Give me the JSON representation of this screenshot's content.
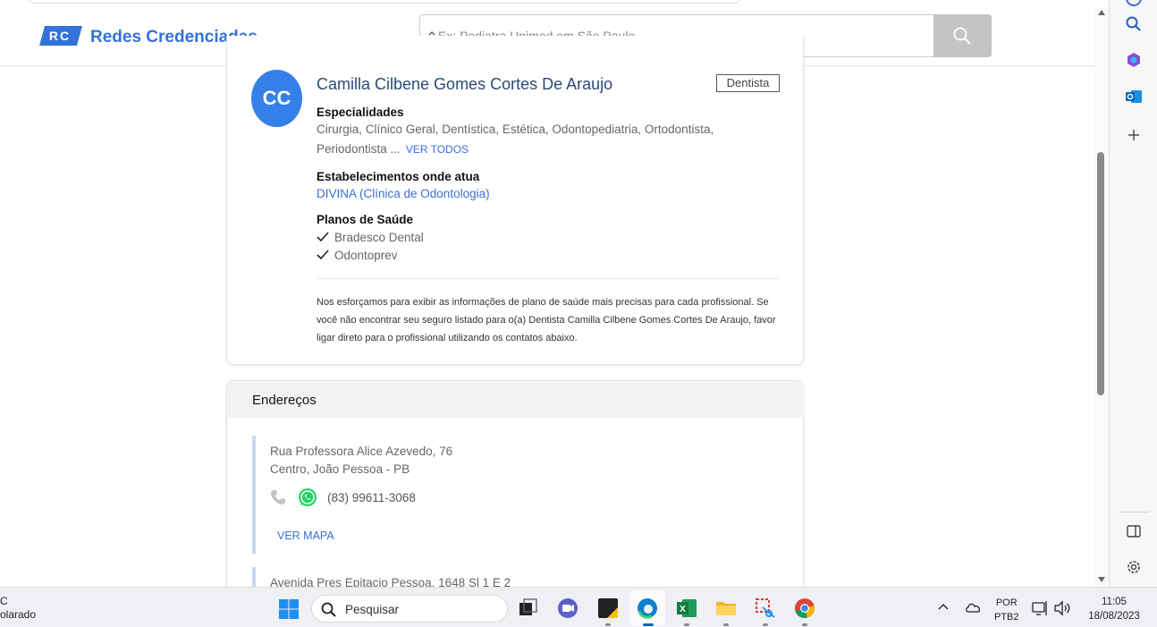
{
  "header": {
    "logo_text": "RC",
    "brand": "Redes Credenciadas",
    "search_placeholder": "Ex: Pediatra Unimed em São Paulo"
  },
  "doctor": {
    "initials": "CC",
    "name": "Camilla Cilbene Gomes Cortes De Araujo",
    "badge": "Dentista",
    "specialties_title": "Especialidades",
    "specialties_line1": "Cirurgia, Clínico Geral, Dentística, Estética, Odontopediatria, Ortodontista,",
    "specialties_line2": "Periodontista ...",
    "see_all": "VER TODOS",
    "establishments_title": "Estabelecimentos onde atua",
    "establishment": "DIVINA (Clínica de Odontologia)",
    "plans_title": "Planos de Saúde",
    "plans": [
      "Bradesco Dental",
      "Odontoprev"
    ],
    "disclaimer": "Nos esforçamos para exibir as informações de plano de saúde mais precisas para cada profissional. Se você não encontrar seu seguro listado para o(a) Dentista Camilla Cilbene Gomes Cortes De Araujo, favor ligar direto para o profissional utilizando os contatos abaixo."
  },
  "addresses": {
    "title": "Endereços",
    "items": [
      {
        "street": "Rua Professora Alice Azevedo, 76",
        "city": "Centro, João Pessoa - PB",
        "phone": "(83) 99611-3068",
        "map_link": "VER MAPA"
      },
      {
        "street": "Avenida Pres Epitacio Pessoa, 1648 Sl 1 E 2"
      }
    ]
  },
  "taskbar": {
    "weather_line1": "C",
    "weather_line2": "olarado",
    "search_label": "Pesquisar",
    "lang_line1": "POR",
    "lang_line2": "PTB2",
    "time": "11:05",
    "date": "18/08/2023"
  },
  "colors": {
    "brand_blue": "#3373d9",
    "avatar_blue": "#3580e8",
    "link_blue": "#3a6fd8",
    "whatsapp_green": "#25d366"
  }
}
